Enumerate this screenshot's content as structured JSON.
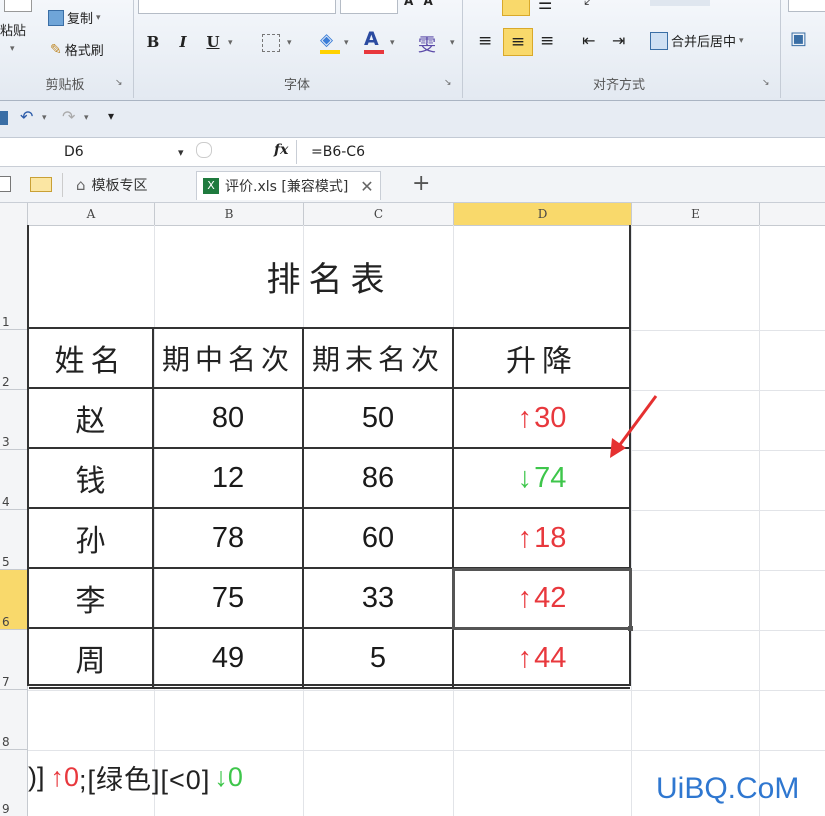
{
  "ribbon": {
    "paste_label": "粘贴",
    "copy_label": "复制",
    "format_painter_label": "格式刷",
    "clipboard_group": "剪贴板",
    "font_group": "字体",
    "align_group": "对齐方式",
    "bold": "B",
    "italic": "I",
    "underline": "U",
    "font_color_glyph": "A",
    "wen_glyph": "雯",
    "merge_center_label": "合并后居中"
  },
  "formula_bar": {
    "name_box": "D6",
    "fx": "fx",
    "formula": "=B6-C6"
  },
  "tabs": [
    {
      "label": "模板专区"
    },
    {
      "label": "评价.xls [兼容模式]"
    }
  ],
  "columns": [
    "A",
    "B",
    "C",
    "D",
    "E"
  ],
  "rows": [
    "1",
    "2",
    "3",
    "4",
    "5",
    "6",
    "7",
    "8",
    "9"
  ],
  "sheet": {
    "title": "排名表",
    "headers": [
      "姓名",
      "期中名次",
      "期末名次",
      "升降"
    ],
    "data": [
      {
        "name": "赵",
        "mid": "80",
        "final": "50",
        "arrow": "↑",
        "change": "30",
        "dir": "up"
      },
      {
        "name": "钱",
        "mid": "12",
        "final": "86",
        "arrow": "↓",
        "change": "74",
        "dir": "down"
      },
      {
        "name": "孙",
        "mid": "78",
        "final": "60",
        "arrow": "↑",
        "change": "18",
        "dir": "up"
      },
      {
        "name": "李",
        "mid": "75",
        "final": "33",
        "arrow": "↑",
        "change": "42",
        "dir": "up"
      },
      {
        "name": "周",
        "mid": "49",
        "final": "5",
        "arrow": "↑",
        "change": "44",
        "dir": "up"
      }
    ],
    "format_note": {
      "prefix": ")]",
      "up_part": "↑0",
      "middle": ";[绿色][<0]",
      "down_part": "↓0"
    }
  },
  "watermark": "UiBQ.CoM",
  "colors": {
    "up": "#e8383d",
    "down": "#3ec64b",
    "selected_header": "#f9d96b",
    "watermark": "#2f77d0",
    "annotation_arrow": "#e53030"
  }
}
